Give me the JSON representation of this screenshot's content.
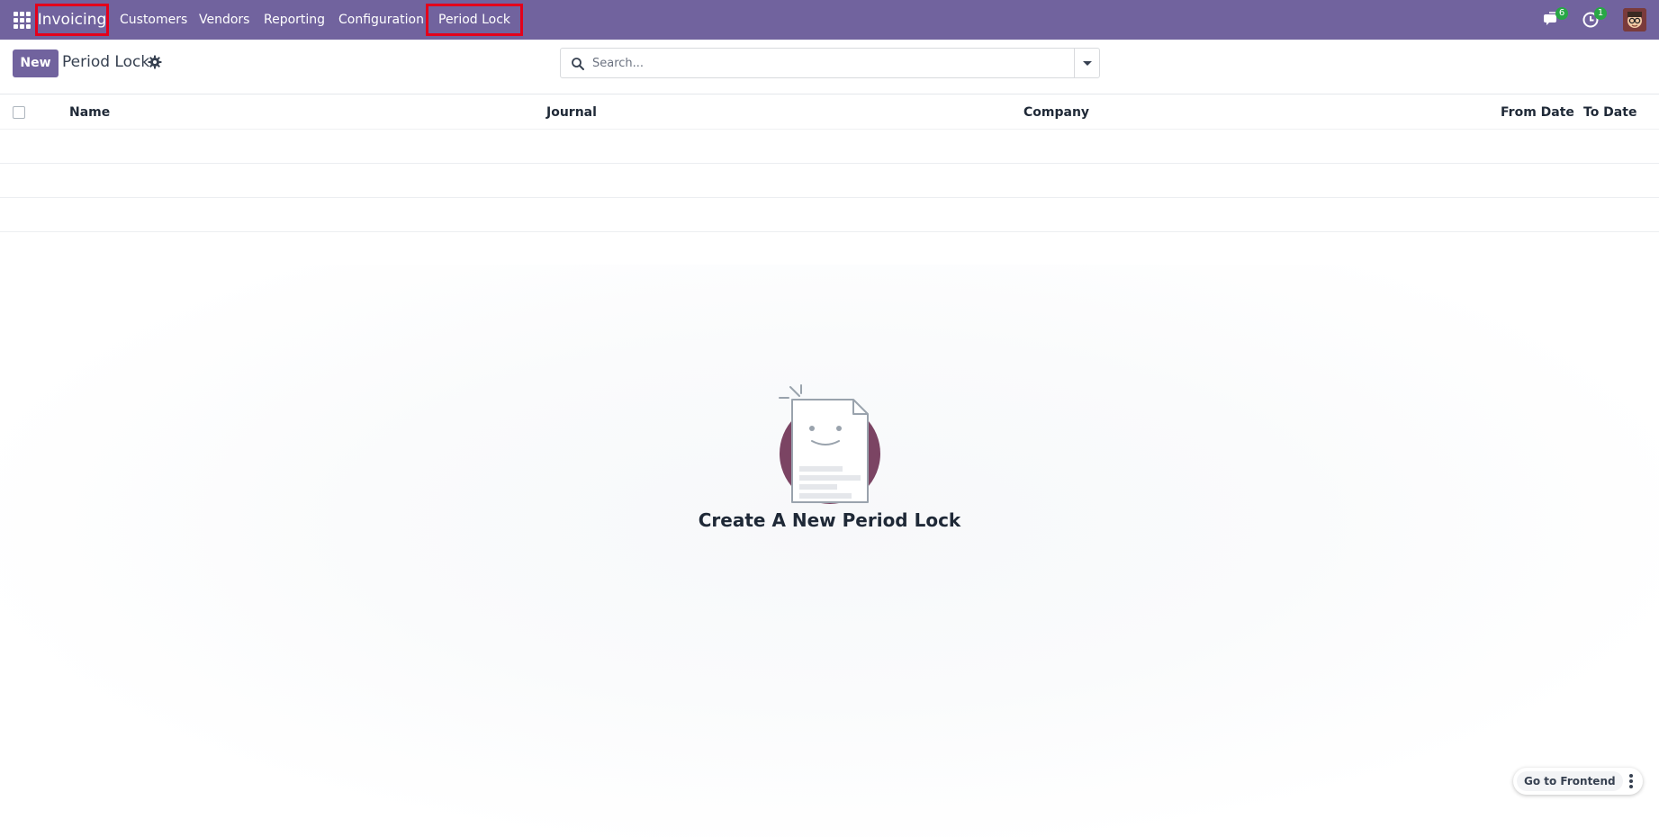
{
  "navbar": {
    "app_name": "Invoicing",
    "menu": [
      "Customers",
      "Vendors",
      "Reporting",
      "Configuration",
      "Period Lock"
    ],
    "messages_count": "6",
    "activities_count": "1"
  },
  "control_panel": {
    "new_label": "New",
    "title": "Period Lock",
    "search_placeholder": "Search..."
  },
  "list": {
    "columns": [
      "Name",
      "Journal",
      "Company",
      "From Date",
      "To Date"
    ]
  },
  "empty_state": {
    "title": "Create A New Period Lock"
  },
  "floating": {
    "frontend_label": "Go to Frontend"
  },
  "colors": {
    "brand": "#71639e",
    "highlight": "#e4001b",
    "badge": "#28a745"
  },
  "icons": [
    "apps-grid-icon",
    "chat-icon",
    "clock-icon",
    "gear-icon",
    "search-icon",
    "caret-down-icon",
    "kebab-icon"
  ]
}
